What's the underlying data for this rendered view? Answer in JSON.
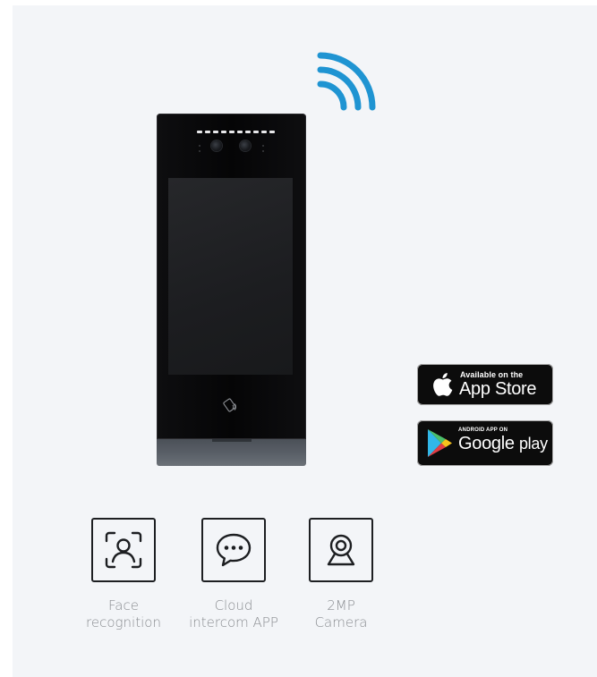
{
  "colors": {
    "background": "#f3f5f8",
    "wifi_blue": "#1f94d2",
    "device_black": "#050506",
    "device_base": "#5a6068",
    "icon_stroke": "#1d1f22",
    "label_gray": "#8a8d91",
    "badge_black": "#0c0c0c"
  },
  "icons": [
    "wifi-icon",
    "nfc-icon",
    "apple-logo-icon",
    "google-play-icon",
    "face-recognition-icon",
    "chat-bubble-icon",
    "camera-icon"
  ],
  "badges": {
    "app_store": {
      "small": "Available on the",
      "big": "App Store"
    },
    "google_play": {
      "small": "ANDROID APP ON",
      "big": "Google",
      "big2": "play"
    }
  },
  "features": [
    {
      "icon": "face-recognition-icon",
      "label": "Face\nrecognition"
    },
    {
      "icon": "chat-bubble-icon",
      "label": "Cloud\nintercom APP"
    },
    {
      "icon": "camera-icon",
      "label": "2MP\nCamera"
    }
  ]
}
